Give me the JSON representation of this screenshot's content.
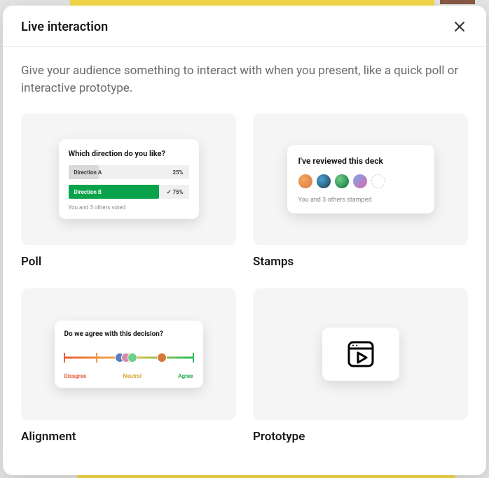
{
  "header": {
    "title": "Live interaction"
  },
  "description": "Give your audience something to interact with when you present, like a quick poll or interactive prototype.",
  "options": {
    "poll": {
      "label": "Poll",
      "preview": {
        "question": "Which direction do you like?",
        "choices": [
          {
            "label": "Direction A",
            "pct": "25%"
          },
          {
            "label": "Direction B",
            "pct": "75%",
            "checked": true
          }
        ],
        "footer": "You and 3 others voted"
      }
    },
    "stamps": {
      "label": "Stamps",
      "preview": {
        "title": "I've reviewed this deck",
        "footer": "You and 3 others stamped"
      }
    },
    "alignment": {
      "label": "Alignment",
      "preview": {
        "question": "Do we agree with this decision?",
        "labels": {
          "disagree": "Disagree",
          "neutral": "Neutral",
          "agree": "Agree"
        }
      }
    },
    "prototype": {
      "label": "Prototype"
    }
  }
}
